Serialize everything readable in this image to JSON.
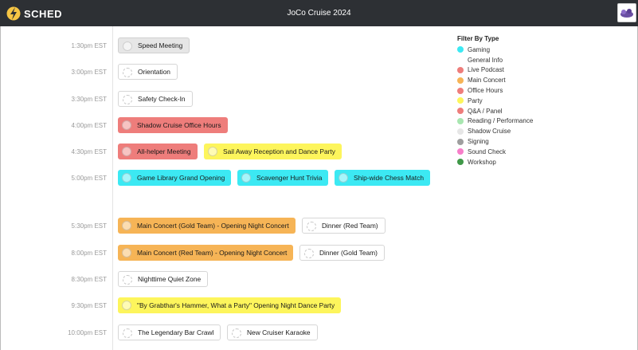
{
  "app": {
    "logo_text": "SCHED",
    "title": "JoCo Cruise 2024"
  },
  "colors": {
    "topbar": "#2d3034",
    "gaming": "#3ce9f3",
    "live_podcast": "#ee7d7b",
    "main_concert": "#f6b456",
    "office_hours": "#ee7d7b",
    "party": "#fdf55c",
    "qa_panel": "#ee7d7b",
    "reading_performance": "#a8e6b0",
    "shadow_cruise": "#e6e6e6",
    "signing": "#9e9e9e",
    "sound_check": "#f77ec9",
    "workshop": "#3f9848"
  },
  "schedule": [
    {
      "time": "1:30pm EST",
      "events": [
        {
          "name": "Speed Meeting",
          "color": "gray"
        }
      ]
    },
    {
      "time": "3:00pm EST",
      "events": [
        {
          "name": "Orientation",
          "color": "white"
        }
      ]
    },
    {
      "time": "3:30pm EST",
      "events": [
        {
          "name": "Safety Check-In",
          "color": "white"
        }
      ]
    },
    {
      "time": "4:00pm EST",
      "events": [
        {
          "name": "Shadow Cruise Office Hours",
          "color": "red"
        }
      ]
    },
    {
      "time": "4:30pm EST",
      "events": [
        {
          "name": "All-helper Meeting",
          "color": "red"
        },
        {
          "name": "Sail Away Reception and Dance Party",
          "color": "yellow"
        }
      ]
    },
    {
      "time": "5:00pm EST",
      "events": [
        {
          "name": "Game Library Grand Opening",
          "color": "cyan"
        },
        {
          "name": "Scavenger Hunt Trivia",
          "color": "cyan"
        },
        {
          "name": "Ship-wide Chess Match",
          "color": "cyan"
        }
      ]
    },
    {
      "time": "5:30pm EST",
      "events": [
        {
          "name": "Main Concert (Gold Team) - Opening Night Concert",
          "color": "orange"
        },
        {
          "name": "Dinner (Red Team)",
          "color": "white"
        }
      ]
    },
    {
      "time": "8:00pm EST",
      "events": [
        {
          "name": "Main Concert (Red Team) - Opening Night Concert",
          "color": "orange"
        },
        {
          "name": "Dinner (Gold Team)",
          "color": "white"
        }
      ]
    },
    {
      "time": "8:30pm EST",
      "events": [
        {
          "name": "Nighttime Quiet Zone",
          "color": "white"
        }
      ]
    },
    {
      "time": "9:30pm EST",
      "events": [
        {
          "name": "\"By Grabthar's Hammer, What a Party\" Opening Night Dance Party",
          "color": "yellow"
        }
      ]
    },
    {
      "time": "10:00pm EST",
      "events": [
        {
          "name": "The Legendary Bar Crawl",
          "color": "white"
        },
        {
          "name": "New Cruiser Karaoke",
          "color": "white"
        }
      ]
    }
  ],
  "filter": {
    "title": "Filter By Type",
    "items": [
      {
        "label": "Gaming",
        "color": "#3ce9f3"
      },
      {
        "label": "General Info",
        "color": ""
      },
      {
        "label": "Live Podcast",
        "color": "#ee7d7b"
      },
      {
        "label": "Main Concert",
        "color": "#f6b456"
      },
      {
        "label": "Office Hours",
        "color": "#ee7d7b"
      },
      {
        "label": "Party",
        "color": "#fdf55c"
      },
      {
        "label": "Q&A / Panel",
        "color": "#ee7d7b"
      },
      {
        "label": "Reading / Performance",
        "color": "#a8e6b0"
      },
      {
        "label": "Shadow Cruise",
        "color": "#e6e6e6"
      },
      {
        "label": "Signing",
        "color": "#9e9e9e"
      },
      {
        "label": "Sound Check",
        "color": "#f77ec9"
      },
      {
        "label": "Workshop",
        "color": "#3f9848"
      }
    ]
  }
}
